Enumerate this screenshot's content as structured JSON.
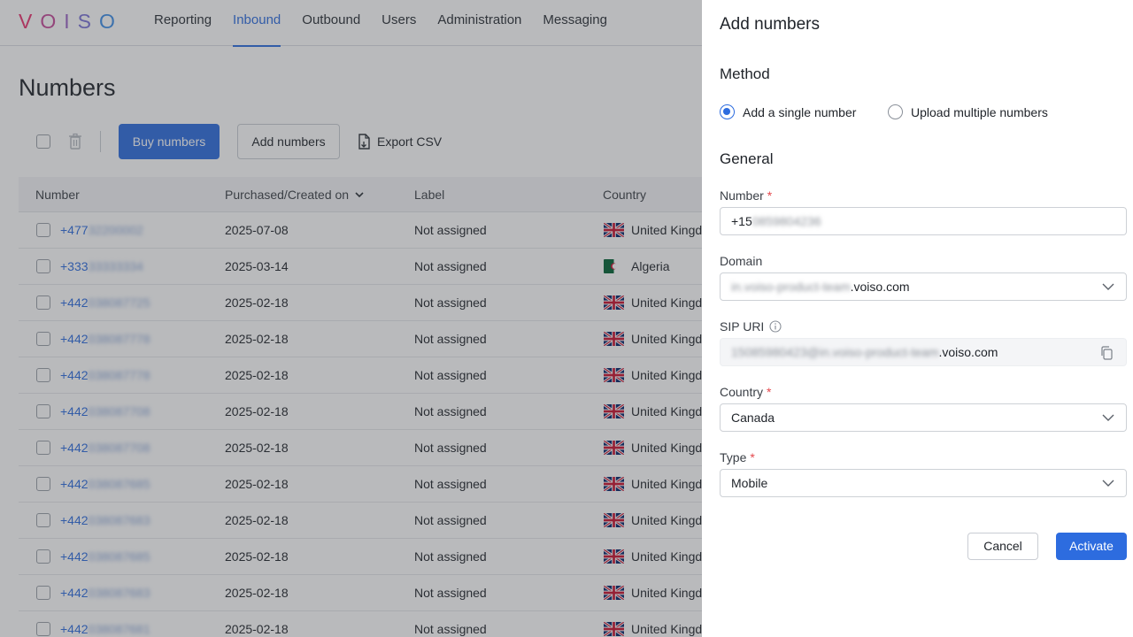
{
  "app": {
    "logo": {
      "letters": [
        "V",
        "O",
        "I",
        "S",
        "O"
      ],
      "colors": [
        "#e9336f",
        "#c54a9a",
        "#9b63c6",
        "#7a72d6",
        "#3e8fe8"
      ]
    },
    "nav": [
      {
        "label": "Reporting",
        "active": false
      },
      {
        "label": "Inbound",
        "active": true
      },
      {
        "label": "Outbound",
        "active": false
      },
      {
        "label": "Users",
        "active": false
      },
      {
        "label": "Administration",
        "active": false
      },
      {
        "label": "Messaging",
        "active": false
      }
    ],
    "page_title": "Numbers",
    "toolbar": {
      "buy_label": "Buy numbers",
      "add_label": "Add numbers",
      "export_label": "Export CSV"
    },
    "table": {
      "columns": [
        "Number",
        "Purchased/Created on",
        "Label",
        "Country"
      ],
      "rows": [
        {
          "prefix": "+477",
          "rest": "32200002",
          "date": "2025-07-08",
          "label": "Not assigned",
          "country": "United Kingd",
          "flag": "uk"
        },
        {
          "prefix": "+333",
          "rest": "33333334",
          "date": "2025-03-14",
          "label": "Not assigned",
          "country": "Algeria",
          "flag": "dz"
        },
        {
          "prefix": "+442",
          "rest": "038087725",
          "date": "2025-02-18",
          "label": "Not assigned",
          "country": "United Kingd",
          "flag": "uk"
        },
        {
          "prefix": "+442",
          "rest": "038087778",
          "date": "2025-02-18",
          "label": "Not assigned",
          "country": "United Kingd",
          "flag": "uk"
        },
        {
          "prefix": "+442",
          "rest": "038087778",
          "date": "2025-02-18",
          "label": "Not assigned",
          "country": "United Kingd",
          "flag": "uk"
        },
        {
          "prefix": "+442",
          "rest": "038087708",
          "date": "2025-02-18",
          "label": "Not assigned",
          "country": "United Kingd",
          "flag": "uk"
        },
        {
          "prefix": "+442",
          "rest": "038087708",
          "date": "2025-02-18",
          "label": "Not assigned",
          "country": "United Kingd",
          "flag": "uk"
        },
        {
          "prefix": "+442",
          "rest": "038087685",
          "date": "2025-02-18",
          "label": "Not assigned",
          "country": "United Kingd",
          "flag": "uk"
        },
        {
          "prefix": "+442",
          "rest": "038087683",
          "date": "2025-02-18",
          "label": "Not assigned",
          "country": "United Kingd",
          "flag": "uk"
        },
        {
          "prefix": "+442",
          "rest": "038087685",
          "date": "2025-02-18",
          "label": "Not assigned",
          "country": "United Kingd",
          "flag": "uk"
        },
        {
          "prefix": "+442",
          "rest": "038087683",
          "date": "2025-02-18",
          "label": "Not assigned",
          "country": "United Kingd",
          "flag": "uk"
        },
        {
          "prefix": "+442",
          "rest": "038087681",
          "date": "2025-02-18",
          "label": "Not assigned",
          "country": "United Kingd",
          "flag": "uk"
        }
      ]
    }
  },
  "drawer": {
    "title": "Add numbers",
    "method": {
      "heading": "Method",
      "options": [
        {
          "label": "Add a single number",
          "selected": true
        },
        {
          "label": "Upload multiple numbers",
          "selected": false
        }
      ]
    },
    "general": {
      "heading": "General",
      "number": {
        "label": "Number",
        "required_mark": "*",
        "value_prefix": "+15",
        "value_blurred": "0859804236"
      },
      "domain": {
        "label": "Domain",
        "value_blurred": "in.voiso-product-team",
        "value_suffix": ".voiso.com"
      },
      "sip_uri": {
        "label": "SIP URI",
        "value_blurred": "15085980423@in.voiso-product-team",
        "value_suffix": ".voiso.com"
      },
      "country": {
        "label": "Country",
        "required_mark": "*",
        "value": "Canada"
      },
      "type": {
        "label": "Type",
        "required_mark": "*",
        "value": "Mobile"
      }
    },
    "cancel_label": "Cancel",
    "activate_label": "Activate"
  },
  "colors": {
    "accent": "#2d6cdf",
    "required": "#e5484d"
  }
}
